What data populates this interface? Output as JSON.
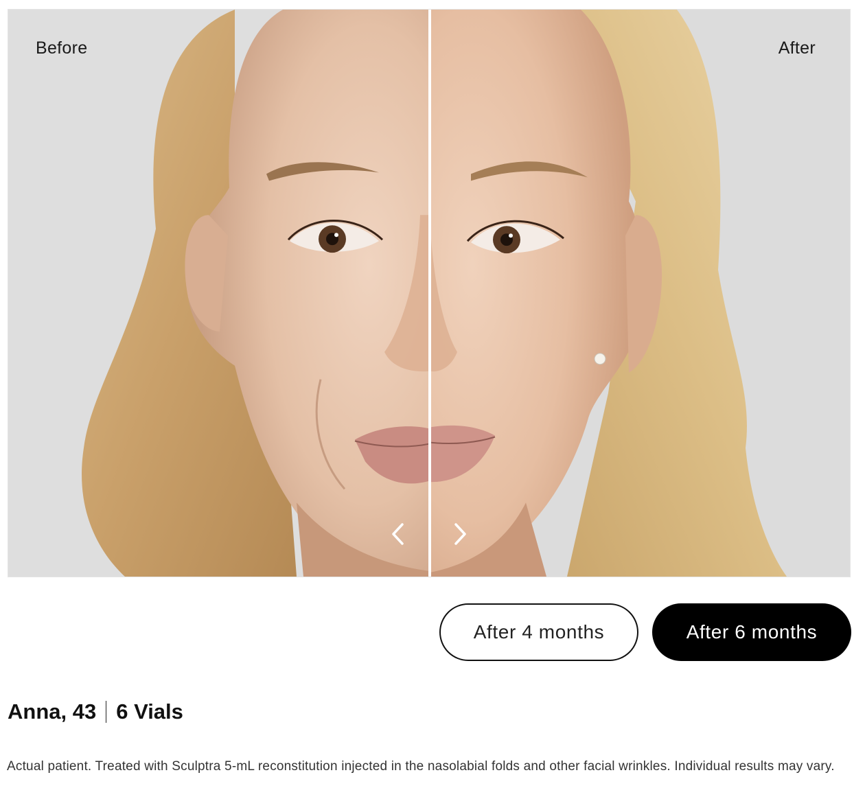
{
  "slider": {
    "before_label": "Before",
    "after_label": "After",
    "prev_icon": "chevron-left-icon",
    "next_icon": "chevron-right-icon"
  },
  "timeframes": {
    "options": [
      "After 4 months",
      "After 6 months"
    ],
    "selected": "After 6 months"
  },
  "patient": {
    "name_age": "Anna, 43",
    "vials": "6 Vials",
    "disclaimer": "Actual patient. Treated with Sculptra 5-mL reconstitution injected in the nasolabial folds and other facial wrinkles. Individual results may vary."
  },
  "colors": {
    "background": "#dcdcdc",
    "selected_button": "#000000",
    "divider": "#ffffff"
  }
}
